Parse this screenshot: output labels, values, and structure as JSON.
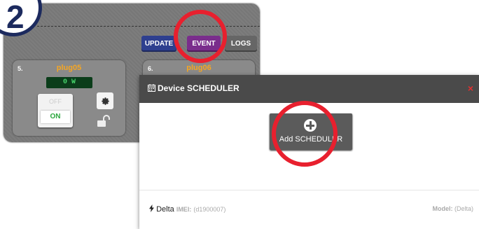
{
  "step": {
    "number": "2"
  },
  "toolbar": {
    "update_label": "UPDATE",
    "event_label": "EVENT",
    "logs_label": "LOGS"
  },
  "plugs": [
    {
      "num": "5.",
      "name": "plug05",
      "power": "0 W",
      "off_label": "OFF",
      "on_label": "ON"
    },
    {
      "num": "6.",
      "name": "plug06"
    }
  ],
  "modal": {
    "title": "Device SCHEDULER",
    "close": "×",
    "add_button_label": "Add SCHEDULER",
    "footer": {
      "device_name": "Delta",
      "imei_label": "IMEI:",
      "imei_value": "(d1900007)",
      "model_label": "Model:",
      "model_value": "(Delta)"
    }
  },
  "colors": {
    "highlight": "#e8202e",
    "update": "#2e3f8f",
    "event": "#7a2d8c",
    "plug_name": "#f5a623",
    "on_text": "#2aa63c"
  },
  "icons": {
    "settings": "gear-icon",
    "lock": "unlock-icon",
    "calendar": "calendar-icon",
    "add": "plus-circle-icon",
    "bolt": "bolt-icon"
  }
}
